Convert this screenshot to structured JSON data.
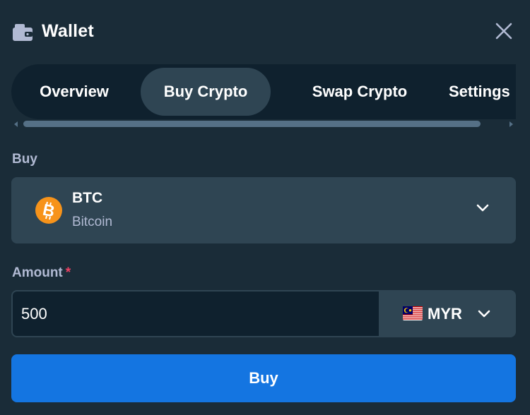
{
  "header": {
    "title": "Wallet",
    "icon": "wallet-icon",
    "close_icon": "close-icon"
  },
  "tabs": [
    {
      "label": "Overview",
      "active": false
    },
    {
      "label": "Buy Crypto",
      "active": true
    },
    {
      "label": "Swap Crypto",
      "active": false
    },
    {
      "label": "Settings",
      "active": false
    }
  ],
  "buy": {
    "label": "Buy",
    "coin": {
      "symbol": "BTC",
      "name": "Bitcoin",
      "icon": "bitcoin-icon",
      "icon_color": "#f7931a"
    }
  },
  "amount": {
    "label": "Amount",
    "required_marker": "*",
    "value": "500",
    "currency": {
      "code": "MYR",
      "icon": "malaysia-flag-icon"
    }
  },
  "buy_button": {
    "label": "Buy"
  },
  "colors": {
    "background": "#1a2c38",
    "surface": "#2f4553",
    "input_bg": "#0f212e",
    "accent": "#1475e1",
    "muted_text": "#b1bad3",
    "required": "#ed4163"
  }
}
